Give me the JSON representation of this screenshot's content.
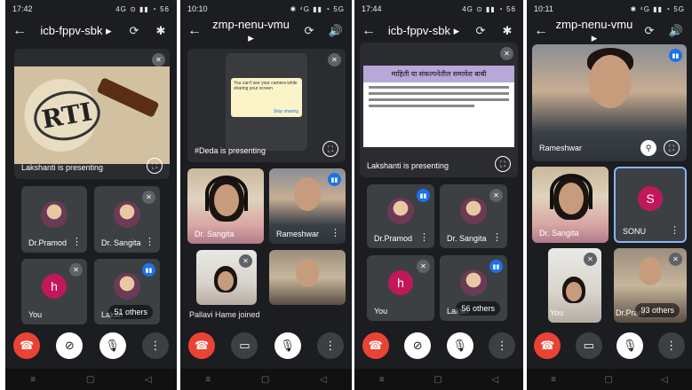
{
  "phones": [
    {
      "status_time": "17:42",
      "status_right": "4G ⊙ ▮▮ ◔ 56",
      "meeting": "icb-fppv-sbk ▸",
      "presenting": "Lakshanti is presenting",
      "tiles": [
        {
          "name": "Dr.Pramod",
          "kind": "photo"
        },
        {
          "name": "Dr. Sangita",
          "kind": "photo"
        },
        {
          "name": "You",
          "kind": "letter",
          "letter": "h"
        },
        {
          "name": "Laksh",
          "kind": "photo",
          "others": "51 others"
        }
      ]
    },
    {
      "status_time": "10:10",
      "status_right": "✱ ⁴G ▮▮ ◔ 5G",
      "meeting": "zmp-nenu-vmu ▸",
      "presenting": "#Deda is presenting",
      "screen_popup": "You can't see your camera while sharing your screen",
      "screen_stop": "Stop sharing",
      "tiles": [
        {
          "name": "Dr. Sangita"
        },
        {
          "name": "Rameshwar"
        },
        {
          "name": ""
        },
        {
          "name": ""
        }
      ],
      "toast": "Pallavi Hame joined"
    },
    {
      "status_time": "17:44",
      "status_right": "4G ⊙ ▮▮ ◔ 56",
      "meeting": "icb-fppv-sbk ▸",
      "presenting": "Lakshanti is presenting",
      "slide_title": "माहिती या संकल्पनेतील समावेश बाबी",
      "tiles": [
        {
          "name": "Dr.Pramod",
          "kind": "photo"
        },
        {
          "name": "Dr. Sangita",
          "kind": "photo"
        },
        {
          "name": "You",
          "kind": "letter",
          "letter": "h"
        },
        {
          "name": "Laksh",
          "kind": "photo",
          "others": "56 others"
        }
      ]
    },
    {
      "status_time": "10:11",
      "status_right": "✱ ⁴G ▮▮ ◔ 5G",
      "meeting": "zmp-nenu-vmu ▸",
      "main_name": "Rameshwar",
      "tiles": [
        {
          "name": "Dr. Sangita"
        },
        {
          "name": "SONU",
          "letter": "S"
        },
        {
          "name": "You"
        },
        {
          "name": "Dr.Pram",
          "others": "93 others"
        }
      ]
    }
  ],
  "colors": {
    "end_call": "#ea4335",
    "speaking": "#1a73e8",
    "letter_avatar": "#c2185b"
  }
}
